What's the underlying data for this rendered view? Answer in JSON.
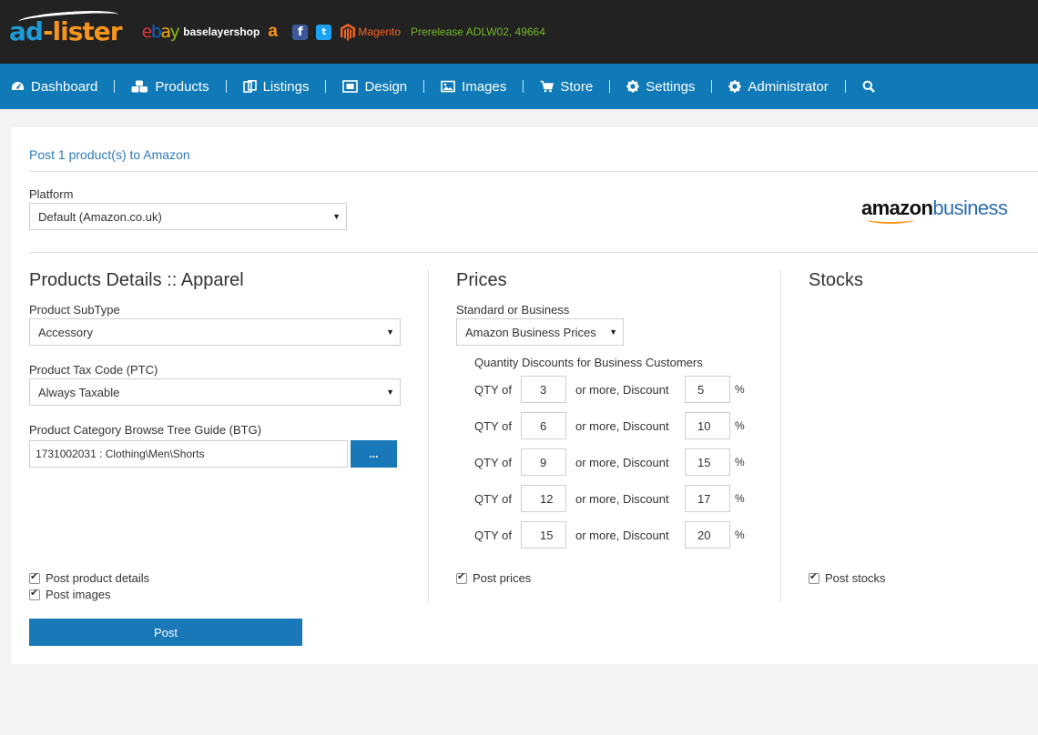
{
  "header": {
    "logo_ad": "ad",
    "logo_lister": "-lister",
    "ebay_e": "e",
    "ebay_b": "b",
    "ebay_a": "a",
    "ebay_y": "y",
    "shop_name": "baselayershop",
    "amazon_glyph": "a",
    "facebook_glyph": "f",
    "twitter_glyph": "t",
    "magento_label": "Magento",
    "prerelease": "Prerelease ADLW02, 49664"
  },
  "nav": {
    "items": [
      {
        "label": "Dashboard",
        "icon": "dashboard-icon"
      },
      {
        "label": "Products",
        "icon": "cubes-icon"
      },
      {
        "label": "Listings",
        "icon": "clipboard-icon"
      },
      {
        "label": "Design",
        "icon": "design-icon"
      },
      {
        "label": "Images",
        "icon": "image-icon"
      },
      {
        "label": "Store",
        "icon": "cart-icon"
      },
      {
        "label": "Settings",
        "icon": "gear-icon"
      },
      {
        "label": "Administrator",
        "icon": "gear-icon"
      }
    ],
    "search_icon": "search-icon"
  },
  "page": {
    "title": "Post 1 product(s) to Amazon",
    "platform_label": "Platform",
    "platform_value": "Default (Amazon.co.uk)",
    "logo_amazon": "amazon",
    "logo_business": "business"
  },
  "details": {
    "title": "Products Details :: Apparel",
    "subtype_label": "Product SubType",
    "subtype_value": "Accessory",
    "ptc_label": "Product Tax Code (PTC)",
    "ptc_value": "Always Taxable",
    "btg_label": "Product Category Browse Tree Guide (BTG)",
    "btg_value": "1731002031 : Clothing\\Men\\Shorts",
    "btg_button": "...",
    "check_details": "Post product details",
    "check_images": "Post images"
  },
  "prices": {
    "title": "Prices",
    "std_label": "Standard or Business",
    "std_value": "Amazon Business Prices",
    "qd_title": "Quantity Discounts for Business Customers",
    "qty_label": "QTY of",
    "mid_label": "or more, Discount",
    "pct": "%",
    "rows": [
      {
        "qty": "3",
        "discount": "5"
      },
      {
        "qty": "6",
        "discount": "10"
      },
      {
        "qty": "9",
        "discount": "15"
      },
      {
        "qty": "12",
        "discount": "17"
      },
      {
        "qty": "15",
        "discount": "20"
      }
    ],
    "check_prices": "Post prices"
  },
  "stocks": {
    "title": "Stocks",
    "check_stocks": "Post stocks"
  },
  "actions": {
    "post": "Post"
  },
  "colors": {
    "nav_bg": "#0f7ab7",
    "header_bg": "#222222",
    "accent": "#1878b8"
  }
}
